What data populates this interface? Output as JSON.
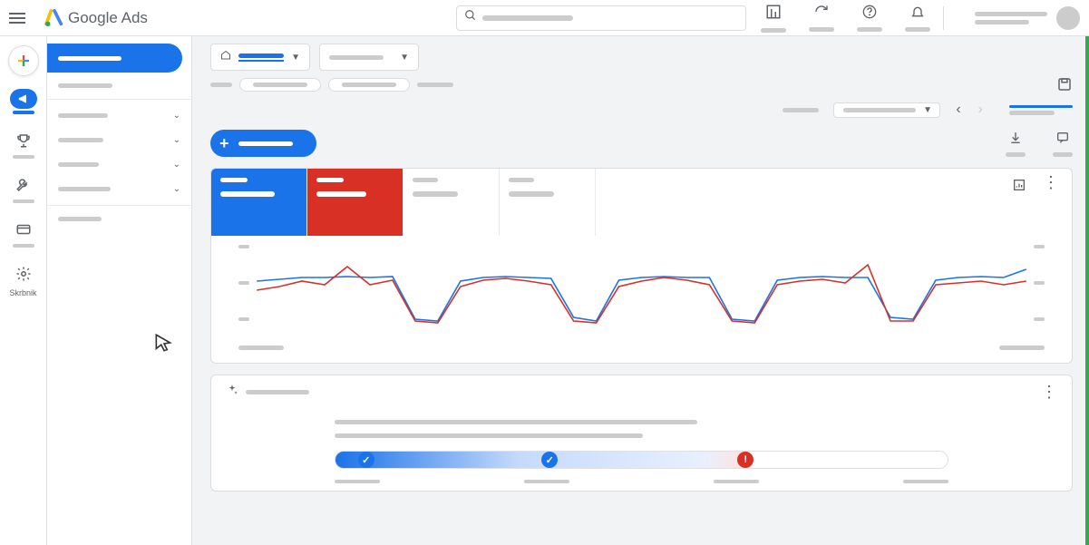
{
  "header": {
    "product": "Google Ads",
    "search_placeholder": "Search"
  },
  "leftrail": {
    "items": [
      {
        "name": "create",
        "icon": "plus"
      },
      {
        "name": "campaigns",
        "icon": "megaphone",
        "active": true
      },
      {
        "name": "goals",
        "icon": "trophy"
      },
      {
        "name": "tools",
        "icon": "wrench"
      },
      {
        "name": "billing",
        "icon": "card"
      },
      {
        "name": "admin",
        "icon": "gear",
        "label": "Skrbnik"
      }
    ]
  },
  "secnav": {
    "items": [
      {
        "active": true
      },
      {
        "expand": false
      },
      {
        "expand": true
      },
      {
        "expand": true
      },
      {
        "expand": true
      },
      {
        "expand": true
      },
      {}
    ]
  },
  "metric_tabs": [
    {
      "color": "blue"
    },
    {
      "color": "red"
    },
    {
      "color": "white"
    },
    {
      "color": "white"
    }
  ],
  "chart_data": {
    "type": "line",
    "x": [
      0,
      1,
      2,
      3,
      4,
      5,
      6,
      7,
      8,
      9,
      10,
      11,
      12,
      13,
      14,
      15,
      16,
      17,
      18,
      19,
      20,
      21,
      22,
      23,
      24,
      25,
      26,
      27,
      28,
      29,
      30,
      31,
      32,
      33,
      34
    ],
    "series": [
      {
        "name": "metric-blue",
        "color": "#1a73e8",
        "values": [
          62,
          64,
          66,
          66,
          67,
          66,
          67,
          20,
          18,
          62,
          66,
          67,
          66,
          65,
          22,
          18,
          63,
          66,
          67,
          66,
          66,
          20,
          18,
          63,
          66,
          67,
          66,
          66,
          22,
          20,
          63,
          66,
          67,
          66,
          75
        ]
      },
      {
        "name": "metric-red",
        "color": "#d93025",
        "values": [
          52,
          56,
          62,
          58,
          78,
          58,
          63,
          18,
          16,
          56,
          63,
          65,
          62,
          58,
          18,
          16,
          56,
          62,
          66,
          63,
          58,
          18,
          16,
          58,
          62,
          64,
          60,
          80,
          18,
          18,
          58,
          60,
          62,
          58,
          62
        ]
      }
    ],
    "ylim": [
      0,
      100
    ]
  },
  "progress": {
    "steps": [
      {
        "state": "done",
        "pct": 5
      },
      {
        "state": "done",
        "pct": 35
      },
      {
        "state": "error",
        "pct": 67
      }
    ]
  }
}
